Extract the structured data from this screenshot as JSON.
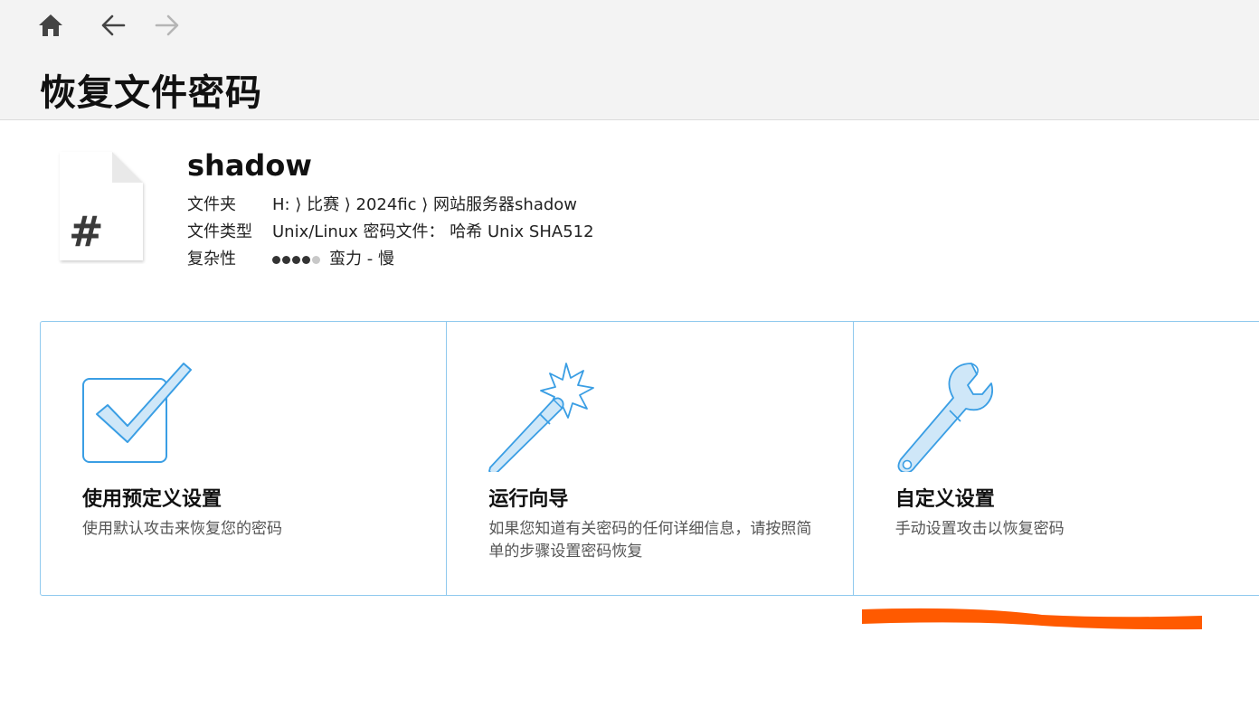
{
  "nav": {
    "home_icon": "home-icon",
    "back_icon": "arrow-left-icon",
    "forward_icon": "arrow-right-icon"
  },
  "page": {
    "title": "恢复文件密码"
  },
  "file": {
    "icon": "hash-file-icon",
    "icon_glyph": "#",
    "name": "shadow",
    "folder_label": "文件夹",
    "folder_value": "H: ⟩ 比赛 ⟩ 2024fic ⟩ 网站服务器shadow",
    "type_label": "文件类型",
    "type_value": "Unix/Linux 密码文件： 哈希 Unix SHA512",
    "complexity_label": "复杂性",
    "complexity_level": 4,
    "complexity_max": 5,
    "complexity_value": "蛮力 - 慢"
  },
  "options": [
    {
      "icon": "checkbox-icon",
      "title": "使用预定义设置",
      "description": "使用默认攻击来恢复您的密码"
    },
    {
      "icon": "magic-wand-icon",
      "title": "运行向导",
      "description": "如果您知道有关密码的任何详细信息，请按照简单的步骤设置密码恢复"
    },
    {
      "icon": "wrench-icon",
      "title": "自定义设置",
      "description": "手动设置攻击以恢复密码"
    }
  ],
  "colors": {
    "accent": "#3a9ee4",
    "card_border": "#8fc9ee",
    "header_bg": "#f3f3f3",
    "annotation": "#ff5a00"
  }
}
